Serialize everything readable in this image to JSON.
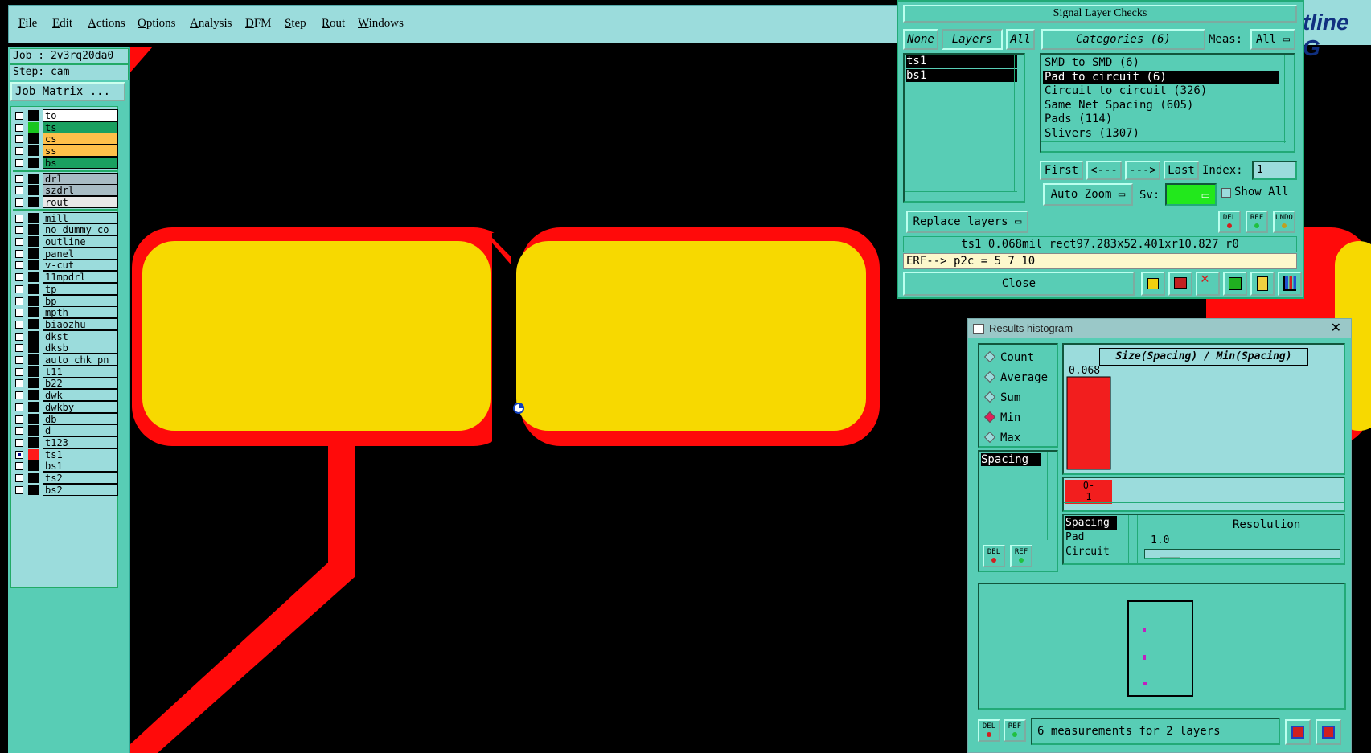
{
  "menu": [
    "File",
    "Edit",
    "Actions",
    "Options",
    "Analysis",
    "DFM",
    "Step",
    "Rout",
    "Windows"
  ],
  "brand_fragment": "tline G",
  "job": {
    "job_line": "Job : 2v3rq20da0",
    "step_line": "Step: cam",
    "matrix_label": "Job Matrix ..."
  },
  "layers": [
    {
      "name": "to",
      "color": "#ffffff",
      "checked": false
    },
    {
      "name": "ts",
      "color": "#1aa060",
      "checked": false,
      "swatch": "#19c61f"
    },
    {
      "name": "cs",
      "color": "#ffc04a",
      "checked": false
    },
    {
      "name": "ss",
      "color": "#ffc04a",
      "checked": false
    },
    {
      "name": "bs",
      "color": "#1aa060",
      "checked": false
    },
    {
      "name": "drl",
      "color": "#a8bcc4",
      "checked": false
    },
    {
      "name": "szdrl",
      "color": "#a8bcc4",
      "checked": false
    },
    {
      "name": "rout",
      "color": "#e8e8e8",
      "checked": false
    },
    {
      "name": "mill",
      "checked": false
    },
    {
      "name": "no_dummy_co",
      "checked": false
    },
    {
      "name": "outline",
      "checked": false
    },
    {
      "name": "panel",
      "checked": false
    },
    {
      "name": "v-cut",
      "checked": false
    },
    {
      "name": "11mpdrl",
      "checked": false
    },
    {
      "name": "tp",
      "checked": false
    },
    {
      "name": "bp",
      "checked": false
    },
    {
      "name": "mpth",
      "checked": false
    },
    {
      "name": "biaozhu",
      "checked": false
    },
    {
      "name": "dkst",
      "checked": false
    },
    {
      "name": "dksb",
      "checked": false
    },
    {
      "name": "auto_chk_pn",
      "checked": false
    },
    {
      "name": "t11",
      "checked": false
    },
    {
      "name": "b22",
      "checked": false
    },
    {
      "name": "dwk",
      "checked": false
    },
    {
      "name": "dwkby",
      "checked": false
    },
    {
      "name": "db",
      "checked": false
    },
    {
      "name": "d",
      "checked": false
    },
    {
      "name": "t123",
      "checked": false
    },
    {
      "name": "ts1",
      "checked": true,
      "swatch": "#ff1a1a"
    },
    {
      "name": "bs1",
      "checked": false
    },
    {
      "name": "ts2",
      "checked": false
    },
    {
      "name": "bs2",
      "checked": false
    }
  ],
  "checks": {
    "title": "Signal Layer Checks",
    "none_btn": "None",
    "layers_btn": "Layers",
    "all_btn": "All",
    "categories_btn": "Categories (6)",
    "meas_label": "Meas:",
    "meas_value": "All",
    "layer_items": [
      "ts1",
      "bs1"
    ],
    "categories": [
      "SMD to SMD (6)",
      "Pad to circuit (6)",
      "Circuit to circuit (326)",
      "Same Net Spacing (605)",
      "Pads (114)",
      "Slivers (1307)"
    ],
    "selected_category": 1,
    "first": "First",
    "prev": "<---",
    "next": "--->",
    "last": "Last",
    "index_label": "Index:",
    "index_value": "1",
    "auto_zoom": "Auto Zoom",
    "sv_label": "Sv:",
    "show_all": "Show All",
    "replace_layers": "Replace layers",
    "del": "DEL",
    "ref": "REF",
    "undo": "UNDO",
    "status": "ts1 0.068mil  rect97.283x52.401xr10.827  r0",
    "erf": "ERF--> p2c = 5 7 10",
    "close": "Close"
  },
  "histogram": {
    "title": "Results histogram",
    "modes": [
      "Count",
      "Average",
      "Sum",
      "Min",
      "Max"
    ],
    "selected_mode": "Min",
    "left_list": [
      "Spacing"
    ],
    "chart_title": "Size(Spacing) / Min(Spacing)",
    "bar_value_label": "0.068",
    "bin_label_top": "0-",
    "bin_label_bottom": "1",
    "types": [
      "Spacing",
      "Pad",
      "Circuit"
    ],
    "resolution_label": "Resolution",
    "resolution_value": "1.0",
    "footer": "6 measurements for 2 layers",
    "del": "DEL",
    "ref": "REF"
  },
  "chart_data": {
    "type": "bar",
    "title": "Size(Spacing) / Min(Spacing)",
    "categories": [
      "0-1"
    ],
    "values": [
      0.068
    ]
  }
}
